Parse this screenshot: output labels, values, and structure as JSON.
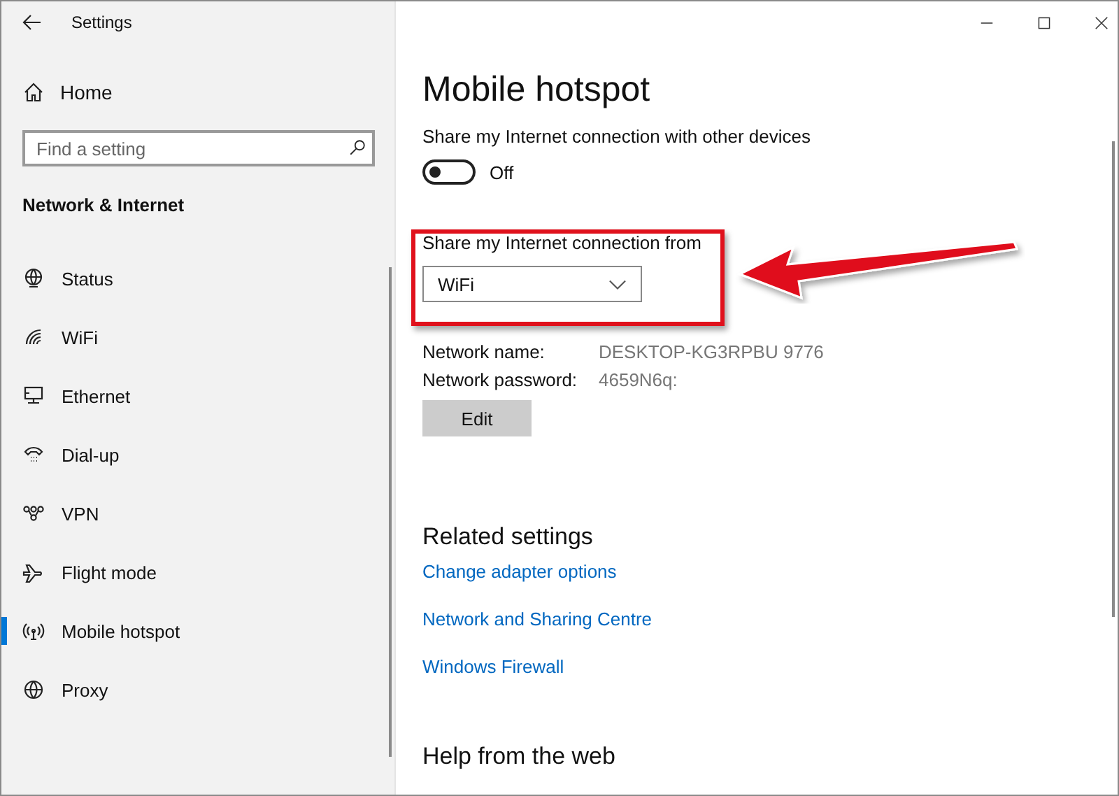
{
  "window": {
    "title": "Settings"
  },
  "sidebar": {
    "home": "Home",
    "search": {
      "placeholder": "Find a setting"
    },
    "section": "Network & Internet",
    "items": [
      {
        "label": "Status",
        "selected": false
      },
      {
        "label": "WiFi",
        "selected": false
      },
      {
        "label": "Ethernet",
        "selected": false
      },
      {
        "label": "Dial-up",
        "selected": false
      },
      {
        "label": "VPN",
        "selected": false
      },
      {
        "label": "Flight mode",
        "selected": false
      },
      {
        "label": "Mobile hotspot",
        "selected": true
      },
      {
        "label": "Proxy",
        "selected": false
      }
    ]
  },
  "main": {
    "title": "Mobile hotspot",
    "share_toggle": {
      "label": "Share my Internet connection with other devices",
      "on": false,
      "state_text": "Off"
    },
    "share_from": {
      "label": "Share my Internet connection from",
      "value": "WiFi"
    },
    "details": [
      {
        "label": "Network name:",
        "value": "DESKTOP-KG3RPBU 9776"
      },
      {
        "label": "Network password:",
        "value": "4659N6q:"
      }
    ],
    "edit_button": "Edit",
    "related": {
      "heading": "Related settings",
      "links": [
        "Change adapter options",
        "Network and Sharing Centre",
        "Windows Firewall"
      ]
    },
    "help_heading": "Help from the web"
  }
}
